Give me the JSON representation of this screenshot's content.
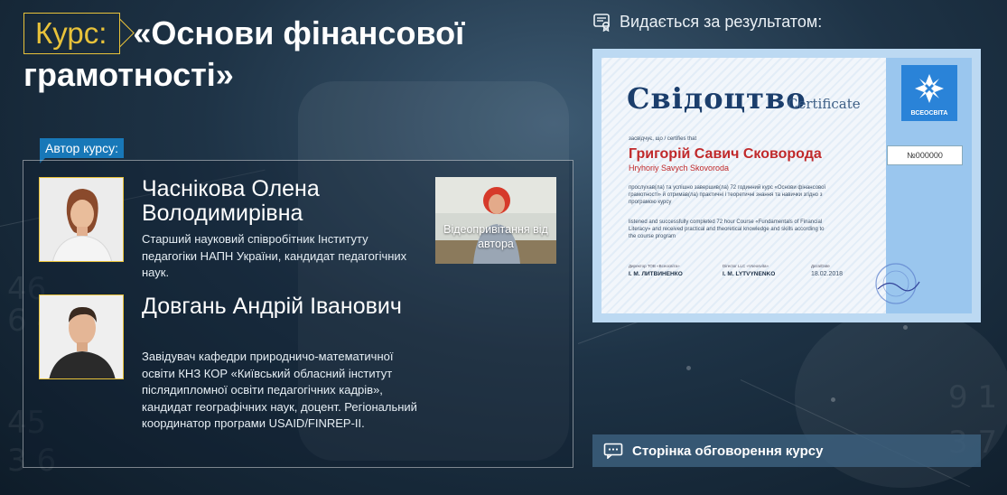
{
  "course": {
    "tag": "Курс:",
    "title": "«Основи фінансової грамотності»"
  },
  "authors_label": "Автор курсу:",
  "authors": [
    {
      "name": "Часнікова Олена Володимирівна",
      "description": "Старший науковий співробітник Інституту педагогіки НАПН України, кандидат педагогічних наук."
    },
    {
      "name": "Довгань Андрій Іванович",
      "description": "Завідувач кафедри природничо-математичної освіти КНЗ КОР «Київський обласний інститут післядипломної освіти педагогічних кадрів», кандидат географічних наук, доцент. Регіональний координатор програми USAID/FINREP-II."
    }
  ],
  "video": {
    "label": "Відеопривітання від автора"
  },
  "certificate": {
    "heading": "Видається за результатом:",
    "title_ua": "Свідоцтво",
    "title_en": "Certificate",
    "certifies": "засвідчує, що / certifies that",
    "name_ua": "Григорій Савич Сковорода",
    "name_en": "Hryhoriy Savych Skovoroda",
    "text_ua": "прослухав(ла) та успішно завершив(ла) 72 годинний курс «Основи фінансової грамотності» й отримав(ла) практичні і теоретичні знання та навички згідно з програмою курсу",
    "text_en": "listened and successfully completed 72 hour Course «Fundamentals of Financial Literacy» and received practical and theoretical knowledge and skills according to the course program",
    "signer1_label": "Директор ТОВ «Всеосвіта»",
    "signer1": "І. М. ЛИТВИНЕНКО",
    "signer2_label": "Director LLC «Vseosvita»",
    "signer2": "I. M. LYTVYNENKO",
    "date_label": "Дата/Date",
    "date": "18.02.2018",
    "number": "№000000",
    "logo_text": "ВСЕОСВІТА"
  },
  "discussion_button": "Сторінка обговорення курсу",
  "colors": {
    "accent_gold": "#e8c23a",
    "badge_blue": "#1878b8",
    "name_red": "#c0292b"
  },
  "icons": {
    "certificate": "certificate-icon",
    "discussion": "chat-icon"
  }
}
